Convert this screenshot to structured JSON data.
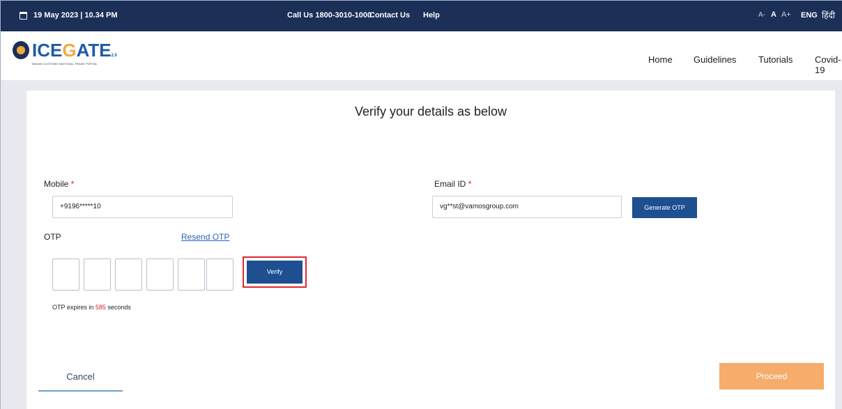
{
  "topbar": {
    "date": "19 May 2023 | 10.34 PM",
    "call": "Call Us  1800-3010-1000",
    "contact": "Contact Us",
    "help": "Help",
    "font_small": "A-",
    "font_normal": "A",
    "font_large": "A+",
    "lang_en": "ENG",
    "lang_hi": "हिंदी"
  },
  "header": {
    "logo_pre": "ICE",
    "logo_accent": "G",
    "logo_post": "ATE",
    "logo_suffix": "2.0",
    "logo_sub": "INDIAN CUSTOMS NATIONAL TRADE PORTAL",
    "nav": [
      "Home",
      "Guidelines",
      "Tutorials",
      "Covid-19"
    ]
  },
  "form": {
    "heading": "Verify your details as below",
    "mobile_label": "Mobile",
    "mobile_value": "+9196*****10",
    "email_label": "Email ID",
    "email_value": "vg**st@vamosgroup.com",
    "required_mark": "*",
    "generate_otp": "Generate OTP",
    "otp_label": "OTP",
    "resend_otp": "Resend OTP",
    "verify": "Verify",
    "expire_prefix": "OTP expires in ",
    "expire_seconds": "585",
    "expire_suffix": " seconds",
    "cancel": "Cancel",
    "proceed": "Proceed"
  },
  "colors": {
    "topbar_bg": "#1b2f57",
    "primary_button": "#1d4f91",
    "proceed_button": "#f6ac6a",
    "highlight_border": "#e0262d"
  }
}
